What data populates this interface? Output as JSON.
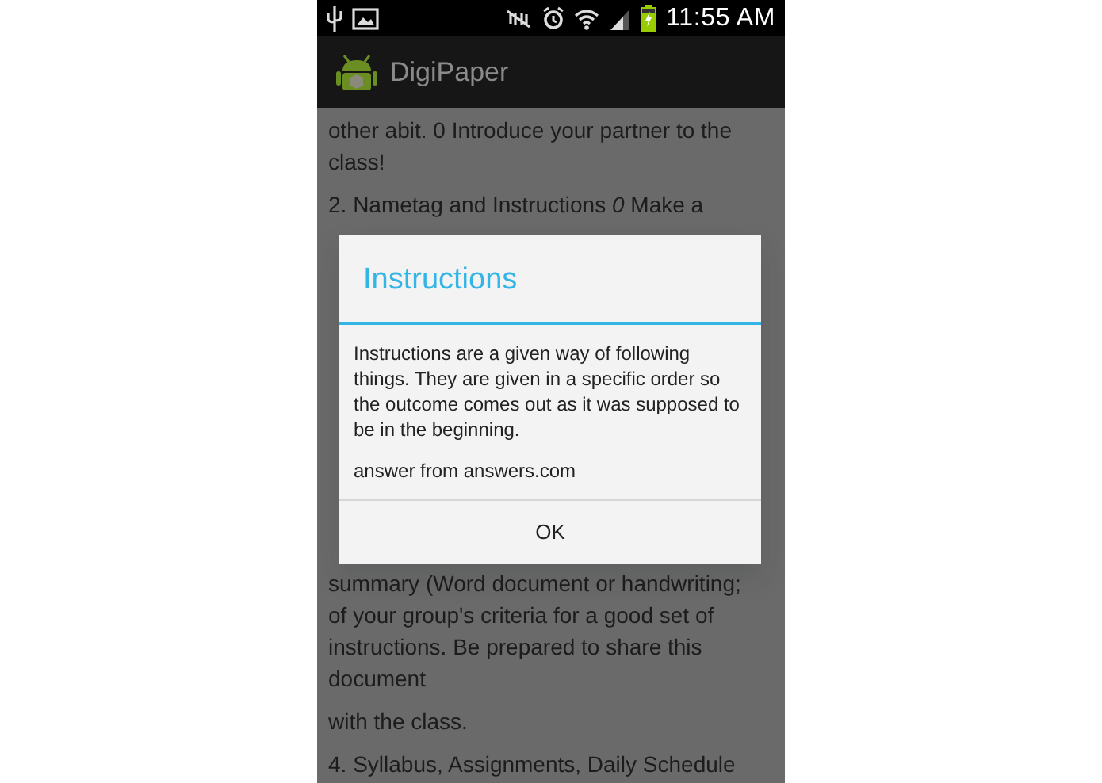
{
  "status_bar": {
    "time": "11:55 AM"
  },
  "action_bar": {
    "title": "DigiPaper"
  },
  "content_top": [
    {
      "lines": [
        "other abit. 0 Introduce your partner to the",
        "class!"
      ]
    },
    {
      "lines": [
        "2. Nametag and Instructions *0* Make a"
      ]
    }
  ],
  "content_bottom": [
    {
      "lines": [
        "summary (Word document or handwriting;",
        "of your group's criteria for a good set of",
        "instructions. Be prepared to share this",
        "document"
      ]
    },
    {
      "lines": [
        "with the class."
      ]
    },
    {
      "lines": [
        "4. Syllabus, Assignments, Daily Schedule"
      ]
    }
  ],
  "dialog": {
    "title": "Instructions",
    "paragraphs": [
      "Instructions are a given way of following things. They are given in a specific order so the outcome comes out as it was supposed to be in the beginning.",
      "answer from answers.com"
    ],
    "buttons": [
      "OK"
    ]
  }
}
